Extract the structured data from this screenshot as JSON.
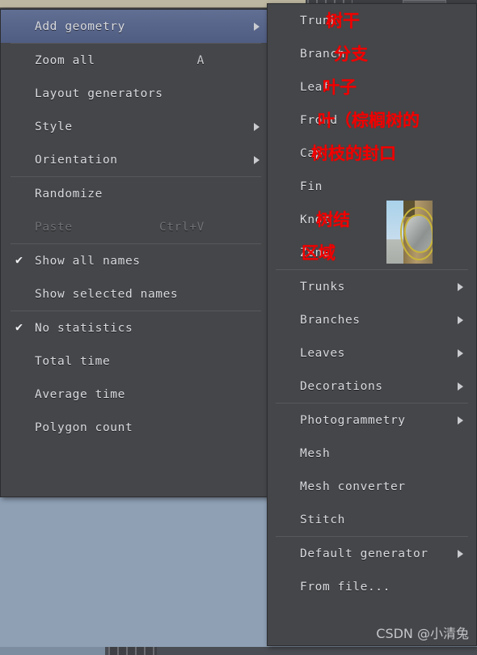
{
  "app": {
    "background_color": "#8fa0b5",
    "menu_background": "#454649",
    "highlight_color": "#58658a",
    "annotation_color": "#f20000"
  },
  "main_menu": {
    "items": [
      {
        "label": "Add geometry",
        "shortcut": "",
        "arrow": true,
        "checked": false,
        "disabled": false,
        "highlighted": true
      },
      {
        "label": "Zoom all",
        "shortcut": "A",
        "arrow": false,
        "checked": false,
        "disabled": false,
        "highlighted": false
      },
      {
        "label": "Layout generators",
        "shortcut": "",
        "arrow": false,
        "checked": false,
        "disabled": false,
        "highlighted": false
      },
      {
        "label": "Style",
        "shortcut": "",
        "arrow": true,
        "checked": false,
        "disabled": false,
        "highlighted": false
      },
      {
        "label": "Orientation",
        "shortcut": "",
        "arrow": true,
        "checked": false,
        "disabled": false,
        "highlighted": false
      },
      {
        "label": "Randomize",
        "shortcut": "",
        "arrow": false,
        "checked": false,
        "disabled": false,
        "highlighted": false
      },
      {
        "label": "Paste",
        "shortcut": "Ctrl+V",
        "arrow": false,
        "checked": false,
        "disabled": true,
        "highlighted": false
      },
      {
        "label": "Show all names",
        "shortcut": "",
        "arrow": false,
        "checked": true,
        "disabled": false,
        "highlighted": false
      },
      {
        "label": "Show selected names",
        "shortcut": "",
        "arrow": false,
        "checked": false,
        "disabled": false,
        "highlighted": false
      },
      {
        "label": "No statistics",
        "shortcut": "",
        "arrow": false,
        "checked": true,
        "disabled": false,
        "highlighted": false
      },
      {
        "label": "Total time",
        "shortcut": "",
        "arrow": false,
        "checked": false,
        "disabled": false,
        "highlighted": false
      },
      {
        "label": "Average time",
        "shortcut": "",
        "arrow": false,
        "checked": false,
        "disabled": false,
        "highlighted": false
      },
      {
        "label": "Polygon count",
        "shortcut": "",
        "arrow": false,
        "checked": false,
        "disabled": false,
        "highlighted": false
      }
    ],
    "check_glyph": "✔"
  },
  "submenu": {
    "items": [
      {
        "label": "Trunk",
        "arrow": false,
        "annotation": "树干"
      },
      {
        "label": "Branch",
        "arrow": false,
        "annotation": "分支"
      },
      {
        "label": "Leaf",
        "arrow": false,
        "annotation": "叶子"
      },
      {
        "label": "Frond",
        "arrow": false,
        "annotation": "叶（棕榈树的"
      },
      {
        "label": "Cap",
        "arrow": false,
        "annotation": "树枝的封口"
      },
      {
        "label": "Fin",
        "arrow": false,
        "annotation": ""
      },
      {
        "label": "Knot",
        "arrow": false,
        "annotation": "树结"
      },
      {
        "label": "Zone",
        "arrow": false,
        "annotation": "区域"
      },
      {
        "label": "Trunks",
        "arrow": true,
        "annotation": ""
      },
      {
        "label": "Branches",
        "arrow": true,
        "annotation": ""
      },
      {
        "label": "Leaves",
        "arrow": true,
        "annotation": ""
      },
      {
        "label": "Decorations",
        "arrow": true,
        "annotation": ""
      },
      {
        "label": "Photogrammetry",
        "arrow": true,
        "annotation": ""
      },
      {
        "label": "Mesh",
        "arrow": false,
        "annotation": ""
      },
      {
        "label": "Mesh converter",
        "arrow": false,
        "annotation": ""
      },
      {
        "label": "Stitch",
        "arrow": false,
        "annotation": ""
      },
      {
        "label": "Default generator",
        "arrow": true,
        "annotation": ""
      },
      {
        "label": "From file...",
        "arrow": false,
        "annotation": ""
      }
    ]
  },
  "watermark": {
    "text": "CSDN @小清兔"
  }
}
